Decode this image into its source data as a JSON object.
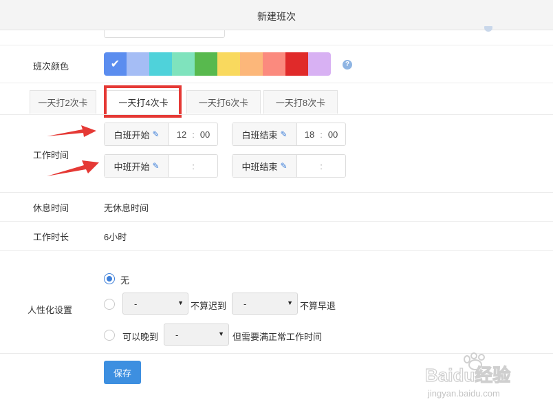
{
  "header": {
    "title": "新建班次"
  },
  "color_row": {
    "label": "班次颜色",
    "swatches": [
      "#5b8def",
      "#a5bdf5",
      "#4fd2da",
      "#7fe3bd",
      "#58b94e",
      "#f9d95e",
      "#fcb77a",
      "#fb8a7e",
      "#e02a2a",
      "#d8b1f3"
    ],
    "selected_index": 0,
    "check": "✔",
    "help": "?"
  },
  "tabs": [
    {
      "label": "一天打2次卡"
    },
    {
      "label": "一天打4次卡"
    },
    {
      "label": "一天打6次卡"
    },
    {
      "label": "一天打8次卡"
    }
  ],
  "active_tab": 1,
  "work_time": {
    "label": "工作时间",
    "day_start": {
      "label": "白班开始",
      "hour": "12",
      "minute": "00"
    },
    "day_end": {
      "label": "白班结束",
      "hour": "18",
      "minute": "00"
    },
    "mid_start": {
      "label": "中班开始",
      "hour": "",
      "minute": ""
    },
    "mid_end": {
      "label": "中班结束",
      "hour": "",
      "minute": ""
    },
    "separator": ":"
  },
  "rest": {
    "label": "休息时间",
    "value": "无休息时间"
  },
  "duration": {
    "label": "工作时长",
    "value": "6小时"
  },
  "humanize": {
    "label": "人性化设置",
    "option_none": "无",
    "late_select": "-",
    "late_text": "不算迟到",
    "early_select": "-",
    "early_text": "不算早退",
    "option_late_prefix": "可以晚到",
    "late_allow_select": "-",
    "option_late_suffix": "但需要满正常工作时间",
    "caret": "▼"
  },
  "save_label": "保存",
  "watermark": {
    "line1": "Baidu经验",
    "line2": "jingyan.baidu.com"
  }
}
